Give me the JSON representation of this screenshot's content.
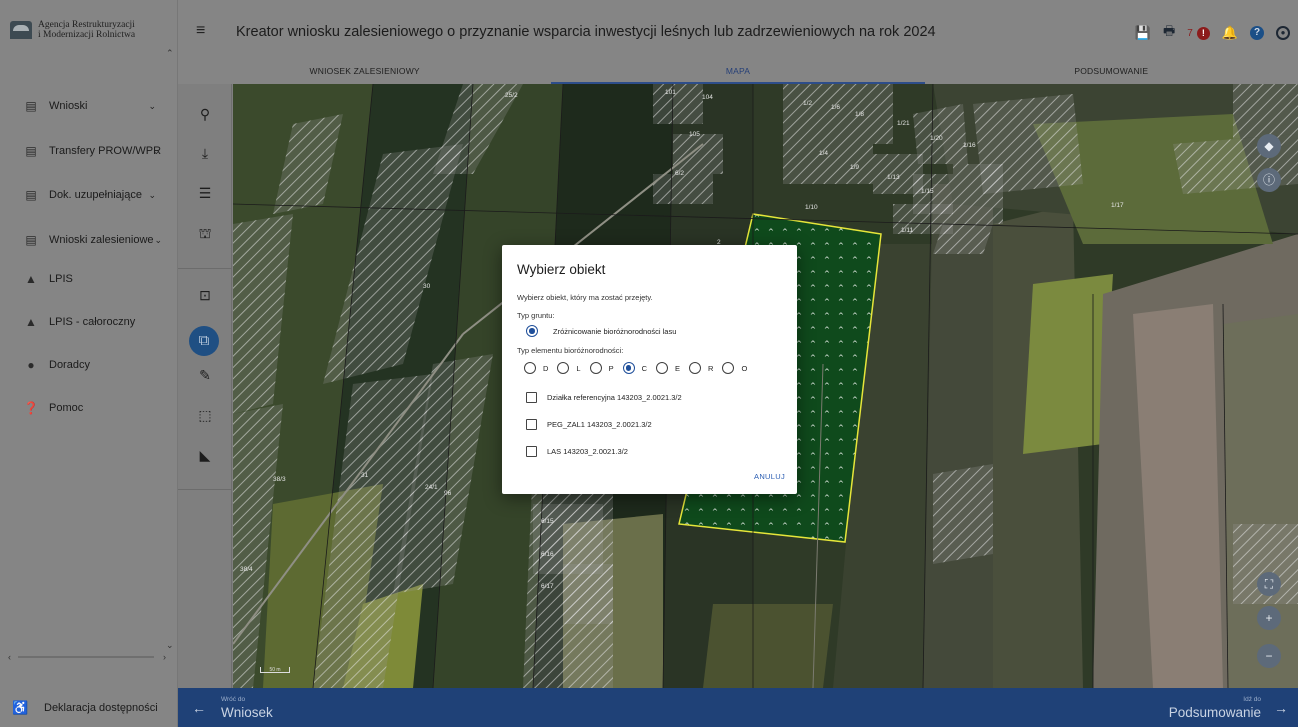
{
  "sidebar": {
    "logo": {
      "line1": "Agencja Restrukturyzacji",
      "line2": "i Modernizacji Rolnictwa"
    },
    "items": [
      {
        "label": "Wnioski",
        "icon": "clipboard-icon",
        "chevron": "⌄"
      },
      {
        "label": "Transfery PROW/WPR",
        "icon": "clipboard-icon",
        "chevron": "⌄"
      },
      {
        "label": "Dok. uzupełniające",
        "icon": "clipboard-icon",
        "chevron": "⌄"
      },
      {
        "label": "Wnioski zalesieniowe",
        "icon": "clipboard-icon",
        "chevron": "⌄"
      },
      {
        "label": "LPIS",
        "icon": "mountain-icon"
      },
      {
        "label": "LPIS - całoroczny",
        "icon": "mountain-icon"
      },
      {
        "label": "Doradcy",
        "icon": "person-icon"
      },
      {
        "label": "Pomoc",
        "icon": "help-circle-icon"
      }
    ],
    "footer": {
      "label": "Deklaracja dostępności",
      "icon": "accessibility-icon"
    }
  },
  "header": {
    "title": "Kreator wniosku zalesieniowego o przyznanie wsparcia inwestycji leśnych lub zadrzewieniowych na rok 2024",
    "notification_count": "7",
    "alert_glyph": "!",
    "help_glyph": "?"
  },
  "tabs": [
    {
      "label": "WNIOSEK ZALESIENIOWY",
      "active": false
    },
    {
      "label": "MAPA",
      "active": true
    },
    {
      "label": "PODSUMOWANIE",
      "active": false
    }
  ],
  "map": {
    "labels": [
      "25/2",
      "101",
      "104",
      "1/2",
      "1/6",
      "1/8",
      "1/21",
      "105",
      "1/20",
      "1/16",
      "1/4",
      "1/9",
      "6/2",
      "1/13",
      "1/15",
      "1/10",
      "1/17",
      "1/11",
      "30",
      "2",
      "38/3",
      "31",
      "24/1",
      "96",
      "6/15",
      "6/16",
      "6/17",
      "38/4",
      "6/2"
    ],
    "scale_label": "50 m"
  },
  "dialog": {
    "title": "Wybierz obiekt",
    "subtitle": "Wybierz obiekt, który ma zostać przejęty.",
    "soil_label": "Typ gruntu:",
    "soil_option": "Zróżnicowanie bioróżnorodności lasu",
    "bio_label": "Typ elementu bioróżnorodności:",
    "bio_options": [
      "D",
      "L",
      "P",
      "C",
      "E",
      "R",
      "O"
    ],
    "bio_selected": "C",
    "checkboxes": [
      "Działka referencyjna 143203_2.0021.3/2",
      "PEG_ZAL1 143203_2.0021.3/2",
      "LAS 143203_2.0021.3/2"
    ],
    "cancel": "ANULUJ"
  },
  "bottom": {
    "back_small": "Wróć do",
    "back_label": "Wniosek",
    "next_small": "Idź do",
    "next_label": "Podsumowanie"
  },
  "colors": {
    "accent": "#1f4177",
    "selected_radio": "#1f4f9a",
    "cancel": "#2b5eb3"
  }
}
